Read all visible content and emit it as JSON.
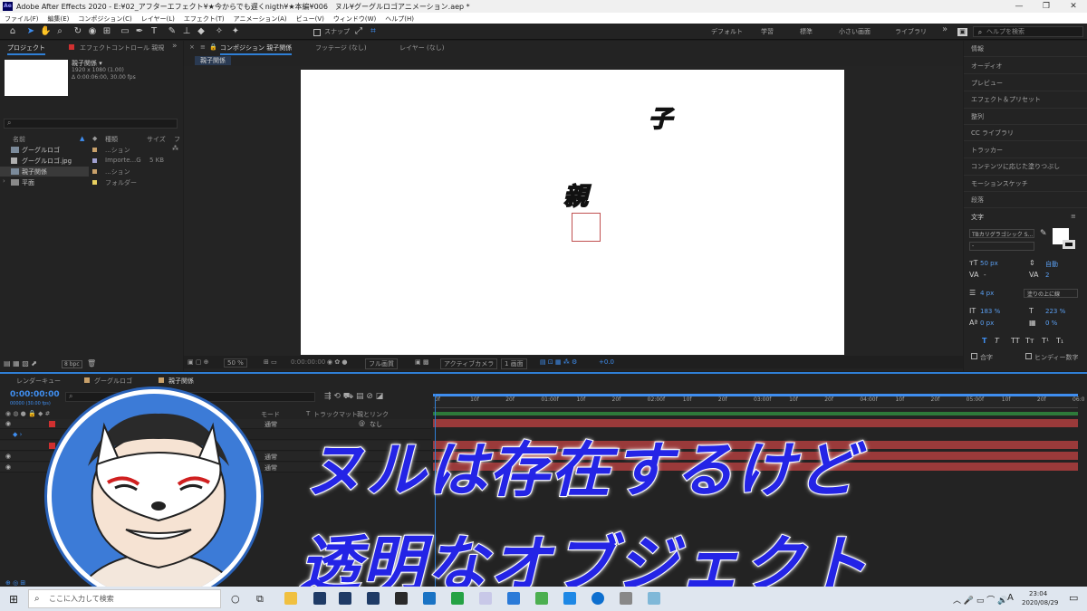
{
  "titlebar": {
    "logo": "Ae",
    "title": "Adobe After Effects 2020 - E:¥02_アフターエフェクト¥★今からでも遅くnigth¥★本編¥006　ヌル¥グーグルロゴアニメーション.aep *",
    "minimize": "—",
    "maximize": "❐",
    "close": "✕"
  },
  "menu": [
    "ファイル(F)",
    "編集(E)",
    "コンポジション(C)",
    "レイヤー(L)",
    "エフェクト(T)",
    "アニメーション(A)",
    "ビュー(V)",
    "ウィンドウ(W)",
    "ヘルプ(H)"
  ],
  "toolbar": {
    "snap_label": "スナップ",
    "workspaces": [
      "デフォルト",
      "学習",
      "標準",
      "小さい画面",
      "ライブラリ"
    ],
    "more": "»",
    "help_placeholder": "ヘルプを検索"
  },
  "project": {
    "tab_project": "プロジェクト",
    "tab_effects": "エフェクトコントロール 親規",
    "more": "»",
    "selected_name": "親子関係 ▾",
    "selected_info1": "1920 x 1080 (1.00)",
    "selected_info2": "Δ 0:00:06:00, 30.00 fps",
    "col_name": "名前",
    "col_type": "種類",
    "col_size": "サイズ",
    "col_extra": "フ",
    "items": [
      {
        "name": "グーグルロゴ",
        "type": "...ション",
        "size": "",
        "color": "#c8a06a"
      },
      {
        "name": "グーグルロゴ.jpg",
        "type": "Importe...G",
        "size": "5 KB",
        "color": "#a0a0d0"
      },
      {
        "name": "親子関係",
        "type": "...ション",
        "size": "",
        "color": "#c8a06a"
      },
      {
        "name": "平面",
        "type": "フォルダー",
        "size": "",
        "color": "#e8d060"
      }
    ],
    "bpc": "8 bpc"
  },
  "comp": {
    "tab_comp": "コンポジション 親子関係",
    "tab_footage": "フッテージ (なし)",
    "tab_layer": "レイヤー (なし)",
    "crumb": "親子関係",
    "child_text": "子",
    "parent_text": "親",
    "zoom": "50 %",
    "timecode": "0:00:00:00",
    "resolution": "フル画質",
    "camera": "アクティブカメラ",
    "views": "1 画面",
    "exposure": "+0.0"
  },
  "right_panel": {
    "items": [
      "情報",
      "オーディオ",
      "プレビュー",
      "エフェクト＆プリセット",
      "整列",
      "CC ライブラリ",
      "トラッカー",
      "コンテンツに応じた塗りつぶし",
      "モーションスケッチ",
      "段落"
    ],
    "char_title": "文字",
    "font": "TBカリグラゴシック S...",
    "font_style": "-",
    "size": "50 px",
    "leading": "自動",
    "kerning": "-",
    "tracking": "2",
    "stroke_width": "4 px",
    "stroke_mode": "塗りの上に線",
    "vscale": "183 %",
    "hscale": "223 %",
    "baseline": "0 px",
    "tsume": "0 %",
    "styles": [
      "T",
      "T",
      "TT",
      "Tт",
      "T¹",
      "T₁"
    ],
    "ligature": "合字",
    "hindi": "ヒンディー数字"
  },
  "timeline": {
    "tab_render": "レンダーキュー",
    "tab_google": "グーグルロゴ",
    "tab_parent": "親子関係",
    "timecode": "0:00:00:00",
    "fps": "00000 (30.00 fps)",
    "ticks": [
      "0f",
      "10f",
      "20f",
      "01:00f",
      "10f",
      "20f",
      "02:00f",
      "10f",
      "20f",
      "03:00f",
      "10f",
      "20f",
      "04:00f",
      "10f",
      "20f",
      "05:00f",
      "10f",
      "20f",
      "06:0"
    ],
    "col_mode": "モード",
    "col_t": "T",
    "col_track": "トラックマット",
    "col_parent": "親とリンク",
    "layers": [
      {
        "mode": "通常",
        "parent": "なし"
      },
      {
        "mode": "通常",
        "parent": ""
      },
      {
        "mode": "通常",
        "parent": ""
      }
    ]
  },
  "overlay": {
    "line1": "ヌルは存在するけど",
    "line2": "透明なオブジェクト"
  },
  "taskbar": {
    "search": "ここに入力して検索",
    "time": "23:04",
    "date": "2020/08/29",
    "ime": "A"
  }
}
